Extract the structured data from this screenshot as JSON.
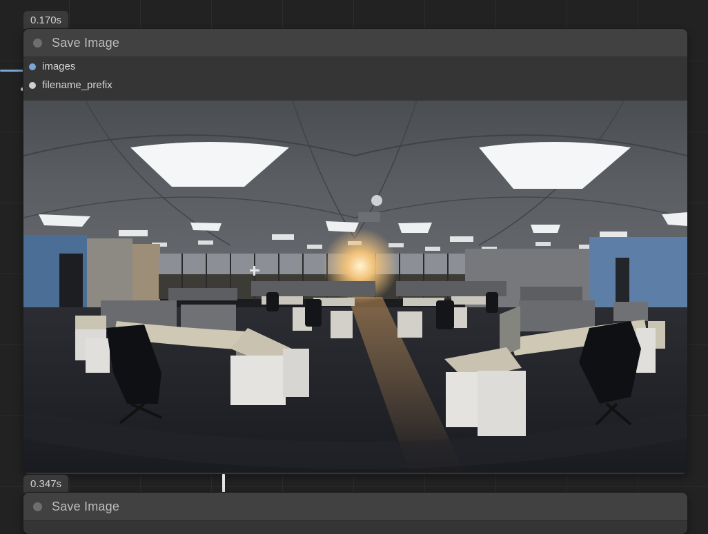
{
  "nodes": [
    {
      "timing": "0.170s",
      "title": "Save Image",
      "inputs": [
        {
          "label": "images",
          "color": "#7aa6d6"
        },
        {
          "label": "filename_prefix",
          "color": "#cfcfcf"
        }
      ],
      "preview": "panoramic-office-photo"
    },
    {
      "timing": "0.347s",
      "title": "Save Image"
    }
  ],
  "colors": {
    "canvas": "#222222",
    "node_body": "#353535",
    "node_header": "#414141",
    "image_link": "#7aa6d6"
  }
}
